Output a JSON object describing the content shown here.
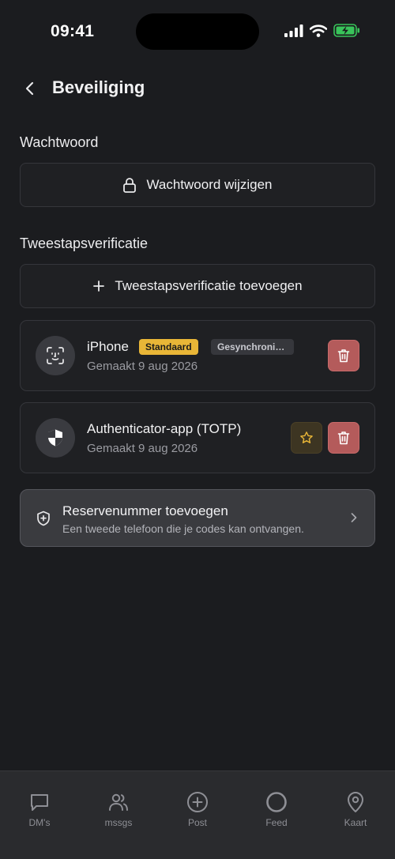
{
  "status_bar": {
    "time": "09:41"
  },
  "header": {
    "title": "Beveiliging"
  },
  "password_section": {
    "title": "Wachtwoord",
    "change_button_label": "Wachtwoord wijzigen"
  },
  "two_factor_section": {
    "title": "Tweestapsverificatie",
    "add_button_label": "Tweestapsverificatie toevoegen",
    "methods": [
      {
        "name": "iPhone",
        "badge_default": "Standaard",
        "badge_sync": "Gesynchroniseerd",
        "created": "Gemaakt 9 aug 2026",
        "icon": "face-id-icon"
      },
      {
        "name": "Authenticator-app (TOTP)",
        "created": "Gemaakt 9 aug 2026",
        "icon": "shield-icon"
      }
    ]
  },
  "backup_number": {
    "title": "Reservenummer toevoegen",
    "subtitle": "Een tweede telefoon die je codes kan ontvangen."
  },
  "tab_bar": {
    "items": [
      {
        "label": "DM's",
        "icon": "chat-bubble-icon"
      },
      {
        "label": "mssgs",
        "icon": "users-icon"
      },
      {
        "label": "Post",
        "icon": "plus-circle-icon"
      },
      {
        "label": "Feed",
        "icon": "circle-icon"
      },
      {
        "label": "Kaart",
        "icon": "map-pin-icon"
      }
    ]
  },
  "colors": {
    "background": "#1b1c1f",
    "badge_default": "#e9b637",
    "delete": "#b45b5b",
    "star": "#e9b637"
  }
}
